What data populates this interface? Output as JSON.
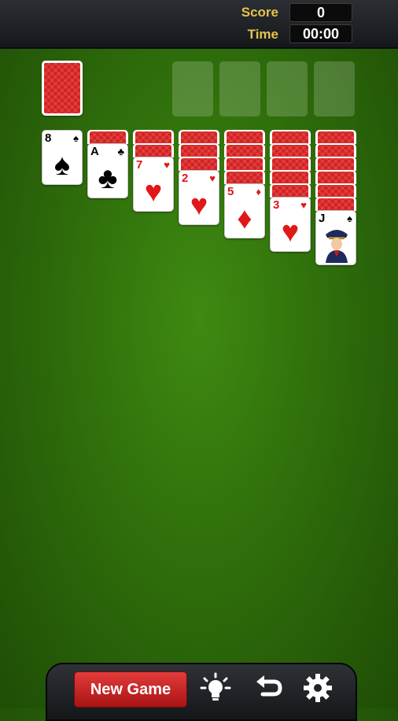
{
  "header": {
    "score_label": "Score",
    "score_value": "0",
    "time_label": "Time",
    "time_value": "00:00"
  },
  "tableau": {
    "faceup": [
      {
        "rank": "8",
        "suit": "♠",
        "color": "black"
      },
      {
        "rank": "A",
        "suit": "♣",
        "color": "black"
      },
      {
        "rank": "7",
        "suit": "♥",
        "color": "red"
      },
      {
        "rank": "2",
        "suit": "♥",
        "color": "red"
      },
      {
        "rank": "5",
        "suit": "♦",
        "color": "red"
      },
      {
        "rank": "3",
        "suit": "♥",
        "color": "red"
      },
      {
        "rank": "J",
        "suit": "♠",
        "color": "black"
      }
    ]
  },
  "toolbar": {
    "new_game_label": "New Game",
    "icons": [
      "lightbulb-icon",
      "undo-icon",
      "gear-icon"
    ]
  },
  "colors": {
    "felt": "#2f6e0b",
    "card_back": "#d62020",
    "accent": "#e6c24e",
    "button_red": "#c82222"
  }
}
